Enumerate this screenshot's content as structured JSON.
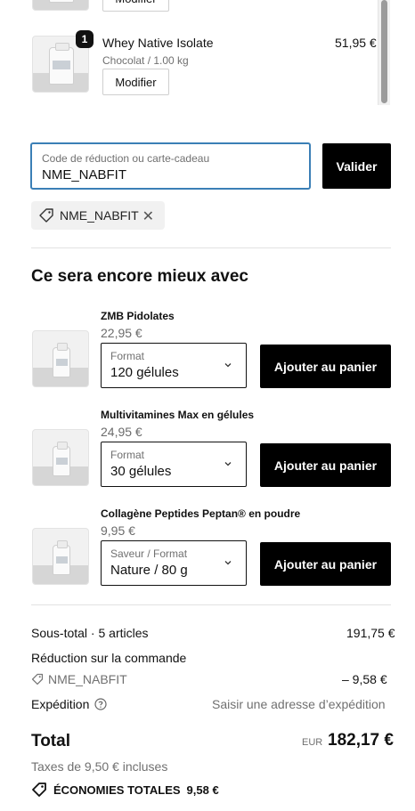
{
  "cart_items": [
    {
      "edit_label": "Modifier"
    },
    {
      "quantity": "1",
      "name": "Whey Native Isolate",
      "variant": "Chocolat / 1.00 kg",
      "price": "51,95 €",
      "edit_label": "Modifier"
    }
  ],
  "discount": {
    "placeholder": "Code de réduction ou carte-cadeau",
    "value": "NME_NABFIT",
    "submit_label": "Valider",
    "applied_code": "NME_NABFIT"
  },
  "recommendations": {
    "title": "Ce sera encore mieux avec",
    "items": [
      {
        "name": "ZMB Pidolates",
        "price": "22,95 €",
        "option_label": "Format",
        "option_value": "120 gélules",
        "add_label": "Ajouter au panier"
      },
      {
        "name": "Multivitamines Max en gélules",
        "price": "24,95 €",
        "option_label": "Format",
        "option_value": "30 gélules",
        "add_label": "Ajouter au panier"
      },
      {
        "name": "Collagène Peptides Peptan® en poudre",
        "price": "9,95 €",
        "option_label": "Saveur / Format",
        "option_value": "Nature / 80 g",
        "add_label": "Ajouter au panier"
      }
    ]
  },
  "summary": {
    "subtotal_label": "Sous-total · 5 articles",
    "subtotal_value": "191,75 €",
    "order_discount_label": "Réduction sur la commande",
    "discount_code": "NME_NABFIT",
    "discount_value": "– 9,58 €",
    "shipping_label": "Expédition",
    "shipping_value": "Saisir une adresse d’expédition",
    "total_label": "Total",
    "currency": "EUR",
    "total_value": "182,17 €",
    "taxes_note": "Taxes de 9,50 € incluses",
    "savings_label": "ÉCONOMIES TOTALES",
    "savings_value": "9,58 €"
  },
  "colors": {
    "focus_border": "#3b7fb6",
    "button_black": "#000000"
  }
}
